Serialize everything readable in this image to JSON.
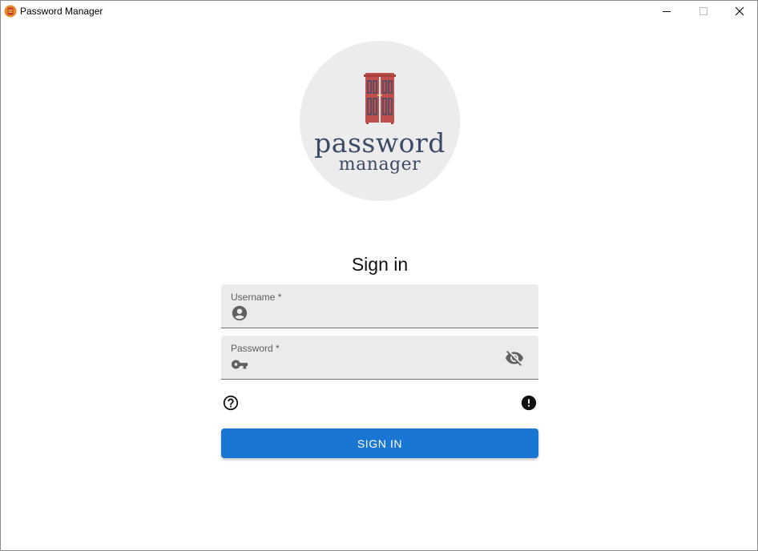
{
  "window": {
    "title": "Password Manager",
    "app_icon": "app-logo-icon",
    "controls": [
      "minimize-icon",
      "maximize-icon",
      "close-icon"
    ]
  },
  "logo": {
    "line1": "password",
    "line2": "manager",
    "icon": "door-icon",
    "colors": {
      "circle": "#ececec",
      "door": "#c0504d",
      "text": "#3d4a66"
    }
  },
  "form": {
    "heading": "Sign in",
    "username": {
      "label": "Username",
      "required_mark": "*",
      "value": "",
      "icon": "account-circle-icon"
    },
    "password": {
      "label": "Password",
      "required_mark": "*",
      "value": "",
      "icon": "key-icon",
      "toggle_icon": "visibility-off-icon"
    },
    "help_icon": "help-circle-icon",
    "alert_icon": "alert-circle-icon",
    "submit_label": "SIGN IN"
  },
  "colors": {
    "primary": "#1976d2",
    "field_bg": "#ebebeb"
  }
}
